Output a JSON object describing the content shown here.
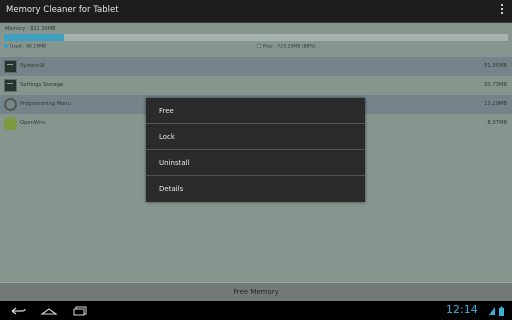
{
  "app": {
    "title": "Memory Cleaner for Tablet"
  },
  "memory": {
    "total_label": "Memory : 821.30MB",
    "used_label": "Used : 98.19MB",
    "free_label": "Free : 723.23MB (88%)",
    "used_fraction": 0.12,
    "used_color": "#3f9fbf"
  },
  "apps": [
    {
      "name": "SystemUI",
      "size": "51.35MB",
      "icon": "terminal-icon",
      "selected": true
    },
    {
      "name": "Settings Storage",
      "size": "20.73MB",
      "icon": "terminal-icon",
      "selected": false
    },
    {
      "name": "Programming Menu",
      "size": "13.29MB",
      "icon": "gear-icon",
      "selected": true
    },
    {
      "name": "OpenWnn",
      "size": "8.37MB",
      "icon": "android-icon",
      "selected": false
    }
  ],
  "context_menu": {
    "items": [
      "Free",
      "Lock",
      "Uninstall",
      "Details"
    ]
  },
  "footer": {
    "free_memory_label": "Free Memory"
  },
  "navbar": {
    "clock": "12:14"
  }
}
